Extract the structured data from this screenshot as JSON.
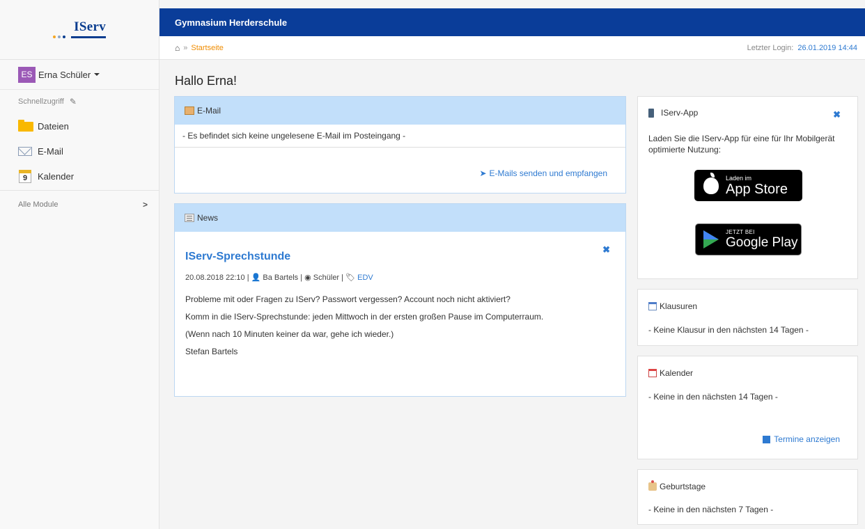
{
  "logo": {
    "text": "IServ",
    "dot_colors": [
      "#f5a623",
      "#8fa8c9",
      "#0a3d8f"
    ]
  },
  "user": {
    "initials": "ES",
    "name": "Erna Schüler"
  },
  "sidebar": {
    "quick_access_label": "Schnellzugriff",
    "items": [
      {
        "label": "Dateien",
        "icon": "folder-icon"
      },
      {
        "label": "E-Mail",
        "icon": "envelope-icon"
      },
      {
        "label": "Kalender",
        "icon": "calendar-icon",
        "icon_text": "9"
      }
    ],
    "all_modules_label": "Alle Module"
  },
  "header": {
    "school_name": "Gymnasium Herderschule"
  },
  "breadcrumb": {
    "separator": "»",
    "current": "Startseite"
  },
  "last_login": {
    "label": "Letzter Login:",
    "date": "26.01.2019 14:44"
  },
  "greeting": "Hallo Erna!",
  "email_panel": {
    "title": "E-Mail",
    "message": "- Es befindet sich keine ungelesene E-Mail im Posteingang -",
    "link": "E-Mails senden und empfangen"
  },
  "news_panel": {
    "title": "News",
    "item_title": "IServ-Sprechstunde",
    "date": "20.08.2018 22:10",
    "author": "Ba Bartels",
    "visibility": "Schüler",
    "tag": "EDV",
    "body": [
      "Probleme mit oder Fragen zu IServ? Passwort vergessen? Account noch nicht aktiviert?",
      "Komm in die IServ-Sprechstunde: jeden Mittwoch in der ersten großen Pause im Computerraum.",
      "(Wenn nach 10 Minuten keiner da war, gehe ich wieder.)",
      "Stefan Bartels"
    ]
  },
  "app_box": {
    "title": "IServ-App",
    "text": "Laden Sie die IServ-App für eine für Ihr Mobilgerät optimierte Nutzung:",
    "appstore_small": "Laden im",
    "appstore_big": "App Store",
    "play_small": "JETZT BEI",
    "play_big": "Google Play"
  },
  "klausuren_box": {
    "title": "Klausuren",
    "text": "- Keine Klausur in den nächsten 14 Tagen -"
  },
  "kalender_box": {
    "title": "Kalender",
    "text": "- Keine in den nächsten 14 Tagen -",
    "link": "Termine anzeigen"
  },
  "geburtstage_box": {
    "title": "Geburtstage",
    "text": "- Keine in den nächsten 7 Tagen -"
  },
  "colors": {
    "header_blue": "#0a3d99",
    "link_blue": "#2e7ad1",
    "breadcrumb_orange": "#f08c00",
    "panel_head_blue": "#c2dffa",
    "avatar_purple": "#9b59b6"
  }
}
